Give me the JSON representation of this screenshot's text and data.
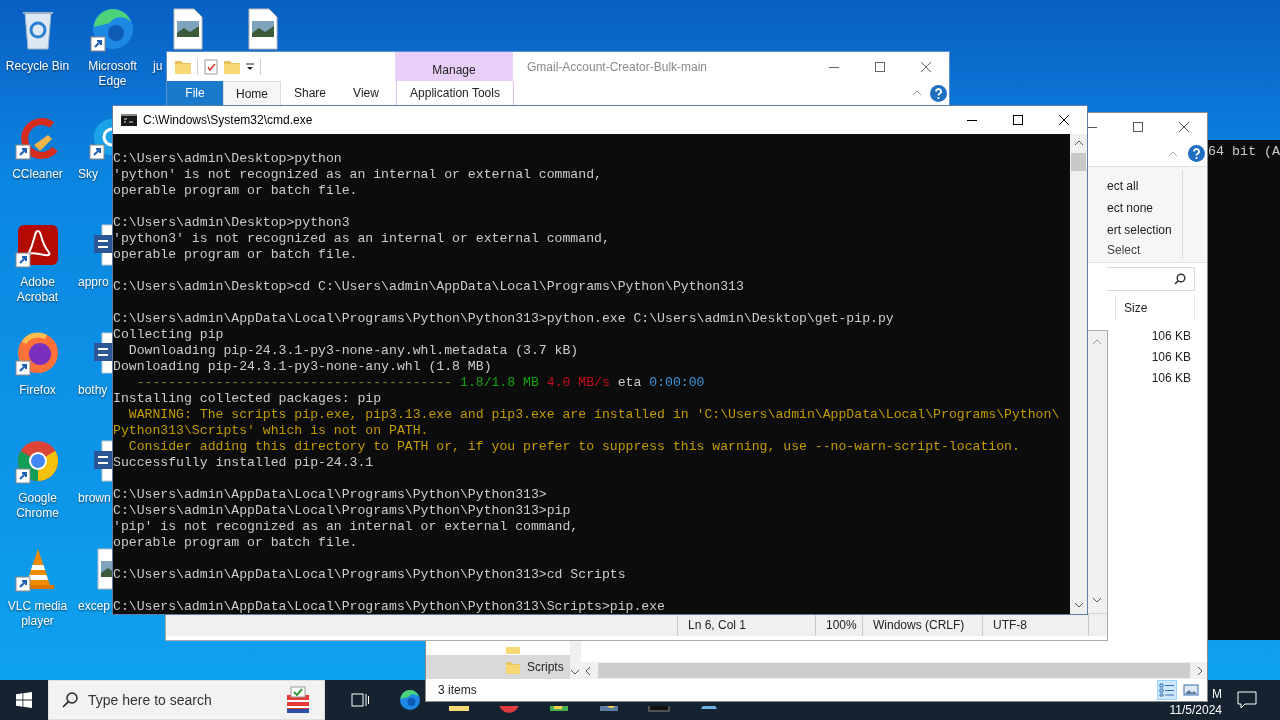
{
  "desktop_columns": [
    {
      "icons": [
        {
          "kind": "recycle",
          "label": "Recycle Bin"
        },
        {
          "kind": "ccleaner",
          "label": "CCleaner"
        },
        {
          "kind": "acrobat",
          "label": "Adobe Acrobat"
        },
        {
          "kind": "firefox",
          "label": "Firefox"
        },
        {
          "kind": "chrome",
          "label": "Google Chrome"
        },
        {
          "kind": "vlc",
          "label": "VLC media player"
        }
      ]
    },
    {
      "icons": [
        {
          "kind": "edge",
          "label": "Microsoft Edge"
        },
        {
          "kind": "skype",
          "label": "Sky"
        },
        {
          "kind": "word",
          "label": "appro"
        },
        {
          "kind": "word",
          "label": "bothy"
        },
        {
          "kind": "word",
          "label": "brown"
        },
        {
          "kind": "image",
          "label": "excep"
        }
      ]
    },
    {
      "icons": [
        {
          "kind": "image",
          "label": "ju"
        }
      ]
    },
    {
      "icons": [
        {
          "kind": "image"
        }
      ]
    }
  ],
  "explorer_back": {
    "title": "Gmail-Account-Creator-Bulk-main",
    "context_tab": "Manage",
    "tabs": [
      {
        "label": "File",
        "kind": "file",
        "selected": false
      },
      {
        "label": "Home",
        "kind": "tab",
        "selected": true
      },
      {
        "label": "Share",
        "kind": "tab",
        "selected": false
      },
      {
        "label": "View",
        "kind": "tab",
        "selected": false
      },
      {
        "label": "Application Tools",
        "kind": "context",
        "selected": false
      }
    ]
  },
  "explorer_front": {
    "select_items": [
      "ect all",
      "ect none",
      "ert selection"
    ],
    "select_group": "Select",
    "column": "Size",
    "rows": [
      {
        "size": "106 KB"
      },
      {
        "size": "106 KB"
      },
      {
        "size": "106 KB"
      }
    ],
    "nav_items": [
      {
        "selected": false
      },
      {
        "label": "Scripts",
        "selected": true
      }
    ],
    "status": "3 items",
    "views": [
      {
        "kind": "details",
        "selected": true
      },
      {
        "kind": "large_icons",
        "selected": false
      }
    ]
  },
  "console_right": {
    "text": "64 bit (A"
  },
  "notepad_status": [
    "Ln 6, Col 1",
    "100%",
    "Windows (CRLF)",
    "UTF-8"
  ],
  "cmd": {
    "title": "C:\\Windows\\System32\\cmd.exe",
    "lines": [
      {
        "kind": "text",
        "text": "C:\\Users\\admin\\Desktop>python"
      },
      {
        "kind": "text",
        "text": "'python' is not recognized as an internal or external command,"
      },
      {
        "kind": "text",
        "text": "operable program or batch file."
      },
      {
        "kind": "blank"
      },
      {
        "kind": "text",
        "text": "C:\\Users\\admin\\Desktop>python3"
      },
      {
        "kind": "text",
        "text": "'python3' is not recognized as an internal or external command,"
      },
      {
        "kind": "text",
        "text": "operable program or batch file."
      },
      {
        "kind": "blank"
      },
      {
        "kind": "text",
        "text": "C:\\Users\\admin\\Desktop>cd C:\\Users\\admin\\AppData\\Local\\Programs\\Python\\Python313"
      },
      {
        "kind": "blank"
      },
      {
        "kind": "text",
        "text": "C:\\Users\\admin\\AppData\\Local\\Programs\\Python\\Python313>python.exe C:\\Users\\admin\\Desktop\\get-pip.py"
      },
      {
        "kind": "text",
        "text": "Collecting pip"
      },
      {
        "kind": "text",
        "text": "  Downloading pip-24.3.1-py3-none-any.whl.metadata (3.7 kB)"
      },
      {
        "kind": "text",
        "text": "Downloading pip-24.3.1-py3-none-any.whl (1.8 MB)"
      },
      {
        "kind": "progress",
        "bar": "----------------------------------------",
        "done": "1.8/1.8 MB",
        "speed": "4.0 MB/s",
        "eta_label": "eta",
        "eta": "0:00:00"
      },
      {
        "kind": "text",
        "text": "Installing collected packages: pip"
      },
      {
        "kind": "warning",
        "text": "  WARNING: The scripts pip.exe, pip3.13.exe and pip3.exe are installed in 'C:\\Users\\admin\\AppData\\Local\\Programs\\Python\\"
      },
      {
        "kind": "warning",
        "text": "Python313\\Scripts' which is not on PATH."
      },
      {
        "kind": "warning",
        "text": "  Consider adding this directory to PATH or, if you prefer to suppress this warning, use --no-warn-script-location."
      },
      {
        "kind": "text",
        "text": "Successfully installed pip-24.3.1"
      },
      {
        "kind": "blank"
      },
      {
        "kind": "text",
        "text": "C:\\Users\\admin\\AppData\\Local\\Programs\\Python\\Python313>"
      },
      {
        "kind": "text",
        "text": "C:\\Users\\admin\\AppData\\Local\\Programs\\Python\\Python313>pip"
      },
      {
        "kind": "text",
        "text": "'pip' is not recognized as an internal or external command,"
      },
      {
        "kind": "text",
        "text": "operable program or batch file."
      },
      {
        "kind": "blank"
      },
      {
        "kind": "text",
        "text": "C:\\Users\\admin\\AppData\\Local\\Programs\\Python\\Python313>cd Scripts"
      },
      {
        "kind": "blank"
      },
      {
        "kind": "text",
        "text": "C:\\Users\\admin\\AppData\\Local\\Programs\\Python\\Python313\\Scripts>pip.exe"
      }
    ]
  },
  "taskbar": {
    "search_placeholder": "Type here to search",
    "apps": [
      {
        "kind": "edge"
      },
      {
        "kind": "folder"
      },
      {
        "kind": "red"
      },
      {
        "kind": "green"
      },
      {
        "kind": "yellow"
      },
      {
        "kind": "console"
      },
      {
        "kind": "blue"
      }
    ],
    "time": "M",
    "date": "11/5/2024"
  }
}
